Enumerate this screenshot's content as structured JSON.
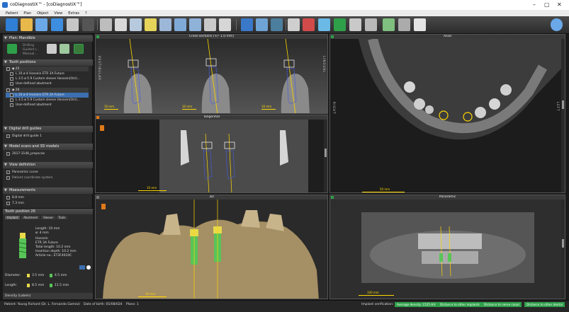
{
  "window": {
    "title": "coDiagnostiX™ - [coDiagnostiX™]"
  },
  "menu": [
    "Patient",
    "Plan",
    "Object",
    "View",
    "Extras",
    "?"
  ],
  "toolbar_icons": [
    "back-icon",
    "open-folder-icon",
    "save-icon",
    "export-icon",
    "print-icon",
    "grid-icon",
    "patient-icon",
    "tooth-icon",
    "model-icon",
    "implant-icon",
    "sleeve-icon",
    "abutment-icon",
    "guide-icon",
    "measure-icon",
    "crosshair-icon",
    "rotate-icon",
    "zoom-icon",
    "volume-icon",
    "panoramic-icon",
    "nerve-icon",
    "annotate-icon",
    "undo-icon",
    "redo-icon",
    "layers-icon",
    "help-icon"
  ],
  "plan": {
    "label": "Plan",
    "name": "Mandible",
    "opts": [
      "Drilling",
      "Guided r...",
      "Manual..."
    ]
  },
  "tooth_positions": {
    "title": "Tooth positions",
    "groups": [
      {
        "num": "25",
        "rows": [
          "L 10  ø 4   Hossein ETR 3A Future",
          "L 3.5  ø 5.9   Custom sleeve Hossein(Oct)...",
          "User-defined abutment"
        ]
      },
      {
        "num": "26",
        "rows": [
          "L 10  ø 4   Hossein ETR 3A Future",
          "L 3.5  ø 5.9   Custom sleeve Hossein(Oct)...",
          "User-defined abutment"
        ]
      }
    ]
  },
  "sections": [
    {
      "title": "Digital drill guides",
      "rows": [
        "Digital drill guide 1"
      ]
    },
    {
      "title": "Model scans and 3D models",
      "rows": [
        "2017-3148_prepscan"
      ]
    },
    {
      "title": "View definition",
      "rows": [
        "Panoramic curve",
        "Patient coordinate system"
      ]
    },
    {
      "title": "Measurements",
      "rows": [
        "8.8 mm",
        "7.3 mm"
      ]
    }
  ],
  "tooth_position_panel": {
    "title": "Tooth position 26",
    "tabs": [
      "Implant",
      "Abutment",
      "Sleeve",
      "Tools"
    ],
    "length": "Length: 10 mm",
    "diameter_top": "ø: 4 mm",
    "brand": "Hossein",
    "model": "ETR 3A Future",
    "total": "Total length: 10.2 mm",
    "insertion": "Insertion depth: 10.2 mm",
    "article": "Article no.: ET3F4010C",
    "diameter_label": "Diameter:",
    "diameter_vals": [
      "3.5 mm",
      "4.5 mm"
    ],
    "length_label": "Length:",
    "length_vals": [
      "8.5 mm",
      "11.5 mm"
    ]
  },
  "density": "Density (Labels)",
  "views": {
    "cross": {
      "title": "Cross-sections (+/- 1.0 mm)",
      "scales": [
        "10 mm",
        "10 mm",
        "10 mm"
      ],
      "side_left": "VESTIBULAR",
      "side_right": "LINGUAL"
    },
    "axial": {
      "title": "Axial",
      "scale": "50 mm",
      "side_left": "RIGHT",
      "side_right": "LEFT"
    },
    "tangential": {
      "title": "Tangential",
      "scale": "10 mm"
    },
    "3d": {
      "title": "3D",
      "scale": "10 mm"
    },
    "panoramic": {
      "title": "Panoramic",
      "scale": "100 mm"
    }
  },
  "status": {
    "patient": "Patient: Young Richard (Dr. L. Fernando Gamez)",
    "dob": "Date of birth: 05/08/024",
    "plans": "Plans: 1",
    "implant_verification": "Implant verification:",
    "pills": [
      "Average density: 1525 HU",
      "Distance to other implants",
      "Distance to nerve canal",
      "Distance to other dental"
    ]
  },
  "colors": {
    "accent_green": "#2fa04a",
    "selected_blue": "#3b6fb0",
    "scale_yellow": "#ffd800",
    "implant_blue": "#4a5bd8"
  }
}
